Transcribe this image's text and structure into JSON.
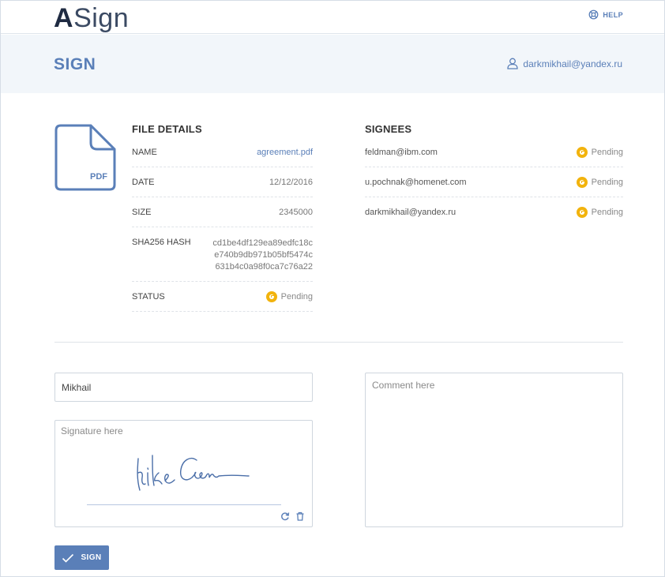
{
  "header": {
    "logo_first": "A",
    "logo_rest": "Sign",
    "help_label": "HELP"
  },
  "subheader": {
    "title": "SIGN",
    "user_email": "darkmikhail@yandex.ru"
  },
  "file_icon_label": "PDF",
  "file_details": {
    "title": "FILE DETAILS",
    "rows": [
      {
        "label": "NAME",
        "value": "agreement.pdf"
      },
      {
        "label": "DATE",
        "value": "12/12/2016"
      },
      {
        "label": "SIZE",
        "value": "2345000"
      },
      {
        "label": "SHA256 HASH",
        "value": "cd1be4df129ea89edfc18ce740b9db971b05bf5474c631b4c0a98f0ca7c76a22"
      },
      {
        "label": "STATUS",
        "value": "Pending"
      }
    ]
  },
  "signees": {
    "title": "SIGNEES",
    "items": [
      {
        "email": "feldman@ibm.com",
        "status": "Pending"
      },
      {
        "email": "u.pochnak@homenet.com",
        "status": "Pending"
      },
      {
        "email": "darkmikhail@yandex.ru",
        "status": "Pending"
      }
    ]
  },
  "form": {
    "name_value": "Mikhail",
    "signature_placeholder": "Signature here",
    "comment_placeholder": "Comment here",
    "sign_button_label": "SIGN"
  },
  "colors": {
    "accent": "#5a7fb8",
    "pending": "#f2b30d",
    "subheader_bg": "#f2f6fa"
  }
}
